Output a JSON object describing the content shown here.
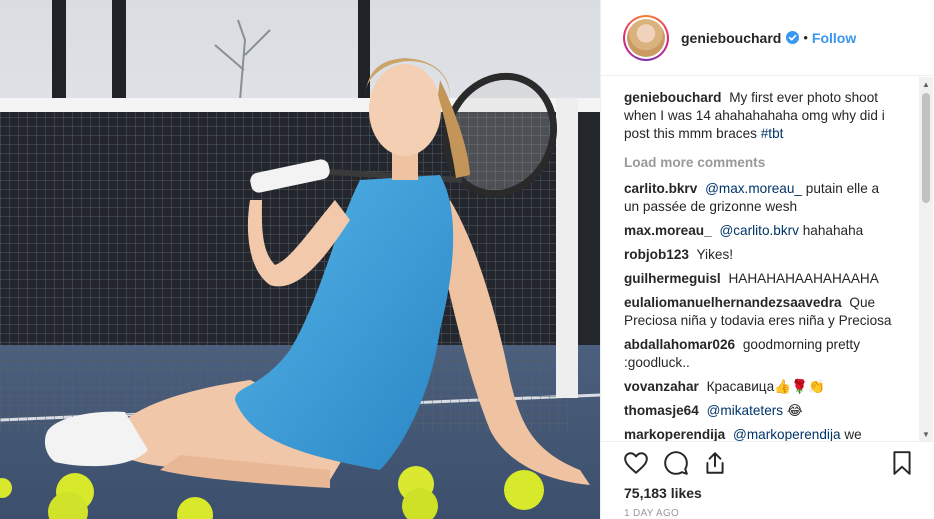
{
  "post": {
    "username": "geniebouchard",
    "follow_label": "Follow",
    "separator": "•",
    "caption_text": "My first ever photo shoot when I was 14 ahahahahaha omg why did i post this mmm braces",
    "caption_hashtag": "#tbt",
    "load_more": "Load more comments",
    "likes": "75,183 likes",
    "time": "1 DAY AGO"
  },
  "comments": [
    {
      "user": "carlito.bkrv",
      "mention": "@max.moreau_",
      "text": "putain elle a un passée de grizonne wesh"
    },
    {
      "user": "max.moreau_",
      "mention": "@carlito.bkrv",
      "text": "hahahaha"
    },
    {
      "user": "robjob123",
      "mention": "",
      "text": "Yikes!"
    },
    {
      "user": "guilhermeguisl",
      "mention": "",
      "text": "HAHAHAHAAHAHAAHA"
    },
    {
      "user": "eulaliomanuelhernandezsaavedra",
      "mention": "",
      "text": "Que Preciosa niña y todavia eres niña y Preciosa"
    },
    {
      "user": "abdallahomar026",
      "mention": "",
      "text": "goodmorning pretty :goodluck.."
    },
    {
      "user": "vovanzahar",
      "mention": "",
      "text": "Красавица👍🌹👏"
    },
    {
      "user": "thomasje64",
      "mention": "@mikateters",
      "text": "😂"
    },
    {
      "user": "markoperendija",
      "mention": "@markoperendija",
      "text": "we"
    }
  ],
  "icons": {
    "verified": "verified-badge-icon",
    "like": "heart-icon",
    "comment": "comment-bubble-icon",
    "share": "share-icon",
    "save": "bookmark-icon"
  },
  "colors": {
    "link": "#3897f0",
    "mention": "#003569",
    "dress": "#3fa0d8",
    "ball": "#d7e92a"
  }
}
